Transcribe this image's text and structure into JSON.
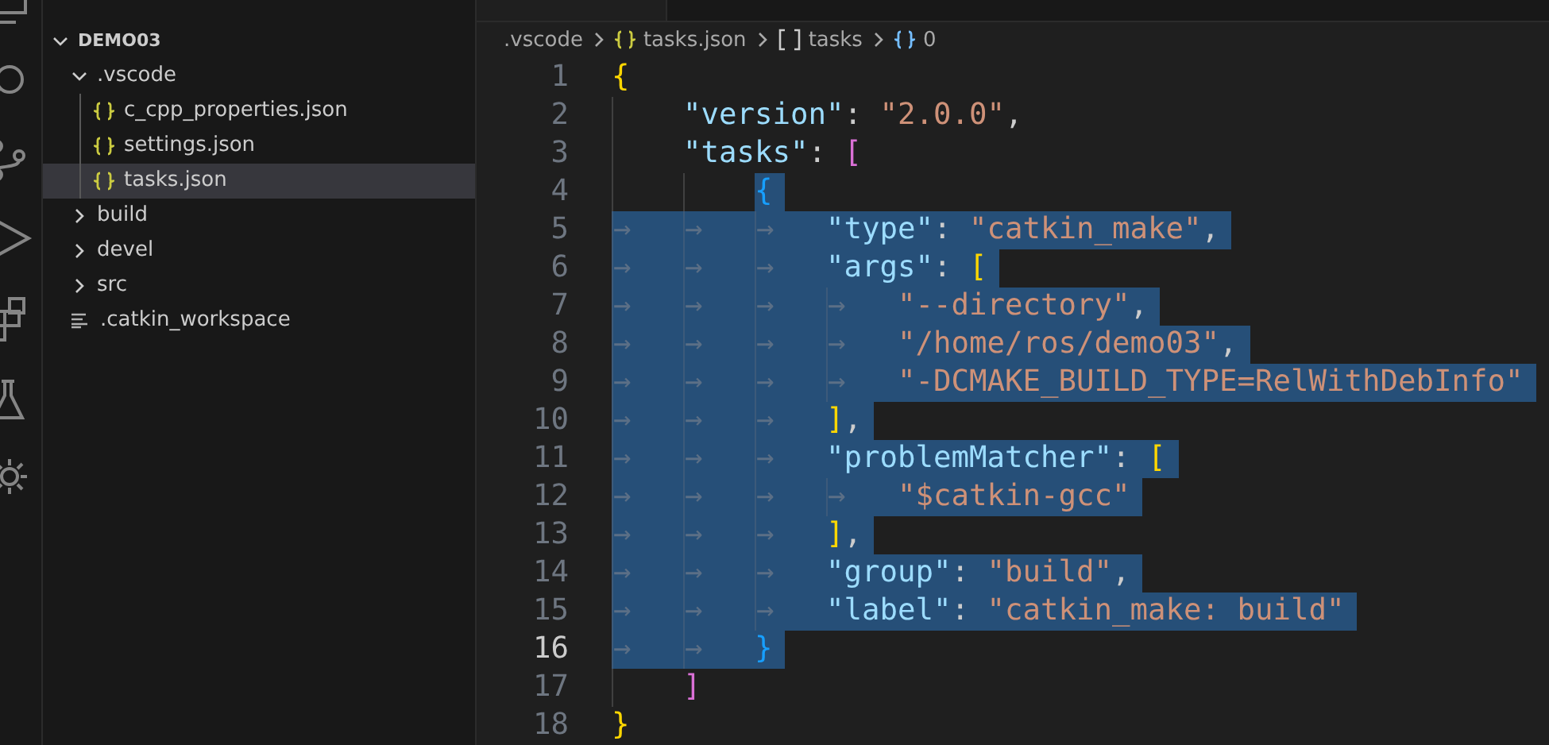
{
  "activity_bar": [
    {
      "kind": "explorer"
    },
    {
      "kind": "search"
    },
    {
      "kind": "source-control"
    },
    {
      "kind": "run"
    },
    {
      "kind": "extensions"
    },
    {
      "kind": "testing"
    },
    {
      "kind": "remote"
    }
  ],
  "explorer": {
    "root": {
      "label": "DEMO03",
      "expanded": true
    },
    "items": [
      {
        "label": ".vscode",
        "kind": "folder",
        "expanded": true,
        "selected": false,
        "children": [
          {
            "label": "c_cpp_properties.json",
            "kind": "json",
            "selected": false
          },
          {
            "label": "settings.json",
            "kind": "json",
            "selected": false
          },
          {
            "label": "tasks.json",
            "kind": "json",
            "selected": true
          }
        ]
      },
      {
        "label": "build",
        "kind": "folder",
        "expanded": false,
        "selected": false
      },
      {
        "label": "devel",
        "kind": "folder",
        "expanded": false,
        "selected": false
      },
      {
        "label": "src",
        "kind": "folder",
        "expanded": false,
        "selected": false
      },
      {
        "label": ".catkin_workspace",
        "kind": "file",
        "selected": false
      }
    ]
  },
  "breadcrumb": [
    {
      "label": ".vscode",
      "kind": "folder"
    },
    {
      "label": "tasks.json",
      "kind": "json"
    },
    {
      "label": "tasks",
      "kind": "array"
    },
    {
      "label": "0",
      "kind": "object"
    }
  ],
  "code_lines": [
    {
      "number": "1",
      "selected": false,
      "current": false,
      "tokens": [
        {
          "kind": "bracket1",
          "text": "{"
        }
      ]
    },
    {
      "number": "2",
      "selected": false,
      "current": false,
      "tokens": [
        {
          "kind": "indent"
        },
        {
          "kind": "key",
          "text": "\"version\""
        },
        {
          "kind": "punct",
          "text": ": "
        },
        {
          "kind": "string",
          "text": "\"2.0.0\""
        },
        {
          "kind": "punct",
          "text": ","
        }
      ]
    },
    {
      "number": "3",
      "selected": false,
      "current": false,
      "tokens": [
        {
          "kind": "indent"
        },
        {
          "kind": "key",
          "text": "\"tasks\""
        },
        {
          "kind": "punct",
          "text": ": "
        },
        {
          "kind": "bracket2",
          "text": "["
        }
      ]
    },
    {
      "number": "4",
      "selected": true,
      "current": false,
      "tokens": [
        {
          "kind": "indent"
        },
        {
          "kind": "indent"
        },
        {
          "kind": "bracket3",
          "text": "{"
        }
      ]
    },
    {
      "number": "5",
      "selected": true,
      "current": false,
      "tokens": [
        {
          "kind": "tab",
          "text": "→"
        },
        {
          "kind": "tab",
          "text": "→"
        },
        {
          "kind": "tab",
          "text": "→"
        },
        {
          "kind": "key",
          "text": "\"type\""
        },
        {
          "kind": "punct",
          "text": ": "
        },
        {
          "kind": "string",
          "text": "\"catkin_make\""
        },
        {
          "kind": "punct",
          "text": ","
        }
      ]
    },
    {
      "number": "6",
      "selected": true,
      "current": false,
      "tokens": [
        {
          "kind": "tab",
          "text": "→"
        },
        {
          "kind": "tab",
          "text": "→"
        },
        {
          "kind": "tab",
          "text": "→"
        },
        {
          "kind": "key",
          "text": "\"args\""
        },
        {
          "kind": "punct",
          "text": ": "
        },
        {
          "kind": "bracket1",
          "text": "["
        }
      ]
    },
    {
      "number": "7",
      "selected": true,
      "current": false,
      "tokens": [
        {
          "kind": "tab",
          "text": "→"
        },
        {
          "kind": "tab",
          "text": "→"
        },
        {
          "kind": "tab",
          "text": "→"
        },
        {
          "kind": "tab",
          "text": "→"
        },
        {
          "kind": "string",
          "text": "\"--directory\""
        },
        {
          "kind": "punct",
          "text": ","
        }
      ]
    },
    {
      "number": "8",
      "selected": true,
      "current": false,
      "tokens": [
        {
          "kind": "tab",
          "text": "→"
        },
        {
          "kind": "tab",
          "text": "→"
        },
        {
          "kind": "tab",
          "text": "→"
        },
        {
          "kind": "tab",
          "text": "→"
        },
        {
          "kind": "string",
          "text": "\"/home/ros/demo03\""
        },
        {
          "kind": "punct",
          "text": ","
        }
      ]
    },
    {
      "number": "9",
      "selected": true,
      "current": false,
      "tokens": [
        {
          "kind": "tab",
          "text": "→"
        },
        {
          "kind": "tab",
          "text": "→"
        },
        {
          "kind": "tab",
          "text": "→"
        },
        {
          "kind": "tab",
          "text": "→"
        },
        {
          "kind": "string",
          "text": "\"-DCMAKE_BUILD_TYPE=RelWithDebInfo\""
        }
      ]
    },
    {
      "number": "10",
      "selected": true,
      "current": false,
      "tokens": [
        {
          "kind": "tab",
          "text": "→"
        },
        {
          "kind": "tab",
          "text": "→"
        },
        {
          "kind": "tab",
          "text": "→"
        },
        {
          "kind": "bracket1",
          "text": "]"
        },
        {
          "kind": "punct",
          "text": ","
        }
      ]
    },
    {
      "number": "11",
      "selected": true,
      "current": false,
      "tokens": [
        {
          "kind": "tab",
          "text": "→"
        },
        {
          "kind": "tab",
          "text": "→"
        },
        {
          "kind": "tab",
          "text": "→"
        },
        {
          "kind": "key",
          "text": "\"problemMatcher\""
        },
        {
          "kind": "punct",
          "text": ": "
        },
        {
          "kind": "bracket1",
          "text": "["
        }
      ]
    },
    {
      "number": "12",
      "selected": true,
      "current": false,
      "tokens": [
        {
          "kind": "tab",
          "text": "→"
        },
        {
          "kind": "tab",
          "text": "→"
        },
        {
          "kind": "tab",
          "text": "→"
        },
        {
          "kind": "tab",
          "text": "→"
        },
        {
          "kind": "string",
          "text": "\"$catkin-gcc\""
        }
      ]
    },
    {
      "number": "13",
      "selected": true,
      "current": false,
      "tokens": [
        {
          "kind": "tab",
          "text": "→"
        },
        {
          "kind": "tab",
          "text": "→"
        },
        {
          "kind": "tab",
          "text": "→"
        },
        {
          "kind": "bracket1",
          "text": "]"
        },
        {
          "kind": "punct",
          "text": ","
        }
      ]
    },
    {
      "number": "14",
      "selected": true,
      "current": false,
      "tokens": [
        {
          "kind": "tab",
          "text": "→"
        },
        {
          "kind": "tab",
          "text": "→"
        },
        {
          "kind": "tab",
          "text": "→"
        },
        {
          "kind": "key",
          "text": "\"group\""
        },
        {
          "kind": "punct",
          "text": ": "
        },
        {
          "kind": "string",
          "text": "\"build\""
        },
        {
          "kind": "punct",
          "text": ","
        }
      ]
    },
    {
      "number": "15",
      "selected": true,
      "current": false,
      "tokens": [
        {
          "kind": "tab",
          "text": "→"
        },
        {
          "kind": "tab",
          "text": "→"
        },
        {
          "kind": "tab",
          "text": "→"
        },
        {
          "kind": "key",
          "text": "\"label\""
        },
        {
          "kind": "punct",
          "text": ": "
        },
        {
          "kind": "string",
          "text": "\"catkin_make: build\""
        }
      ]
    },
    {
      "number": "16",
      "selected": true,
      "current": true,
      "tokens": [
        {
          "kind": "tab",
          "text": "→"
        },
        {
          "kind": "tab",
          "text": "→"
        },
        {
          "kind": "bracket3",
          "text": "}"
        }
      ]
    },
    {
      "number": "17",
      "selected": false,
      "current": false,
      "tokens": [
        {
          "kind": "indent"
        },
        {
          "kind": "bracket2",
          "text": "]"
        }
      ]
    },
    {
      "number": "18",
      "selected": false,
      "current": false,
      "tokens": [
        {
          "kind": "bracket1",
          "text": "}"
        }
      ]
    }
  ]
}
